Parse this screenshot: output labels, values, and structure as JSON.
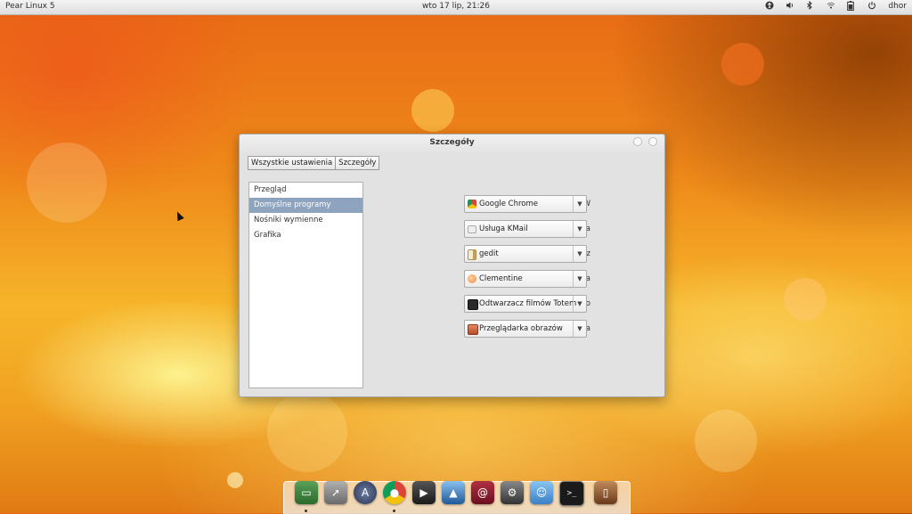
{
  "topbar": {
    "distro": "Pear Linux 5",
    "clock": "wto 17 lip, 21:26",
    "user": "dhor",
    "indicators": [
      "accessibility-icon",
      "volume-icon",
      "bluetooth-icon",
      "wifi-icon",
      "battery-icon",
      "power-icon"
    ]
  },
  "window": {
    "title": "Szczegóły",
    "breadcrumbs": [
      "Wszystkie ustawienia",
      "Szczegóły"
    ],
    "sidebar": {
      "items": [
        "Przegląd",
        "Domyślne programy",
        "Nośniki wymienne",
        "Grafika"
      ],
      "selected_index": 1
    },
    "defaults": [
      {
        "label": "WWW",
        "value": "Google Chrome",
        "icon": "chrome-icon",
        "icon_color": "#d6432f"
      },
      {
        "label": "Poczta",
        "value": "Usługa KMail",
        "icon": "mail-icon",
        "icon_color": "#c9c9c9"
      },
      {
        "label": "Kalendarz",
        "value": "gedit",
        "icon": "text-editor-icon",
        "icon_color": "#e8d8a0"
      },
      {
        "label": "Muzyka",
        "value": "Clementine",
        "icon": "clementine-icon",
        "icon_color": "#f39a5a"
      },
      {
        "label": "Wideo",
        "value": "Odtwarzacz filmów Totem",
        "icon": "video-icon",
        "icon_color": "#333333"
      },
      {
        "label": "Zdjęcia",
        "value": "Przeglądarka obrazów",
        "icon": "image-viewer-icon",
        "icon_color": "#c8603a"
      }
    ]
  },
  "dock": {
    "items": [
      {
        "name": "dock-system-monitor",
        "icon": "monitor-icon",
        "color": "#3a7a3a"
      },
      {
        "name": "dock-launcher",
        "icon": "rocket-icon",
        "color": "#8a8a8a"
      },
      {
        "name": "dock-app-store",
        "icon": "app-store-icon",
        "color": "#3a4a6a"
      },
      {
        "name": "dock-chrome",
        "icon": "chrome-icon",
        "color": "#d6432f"
      },
      {
        "name": "dock-media-player",
        "icon": "play-icon",
        "color": "#333333"
      },
      {
        "name": "dock-photos",
        "icon": "photos-icon",
        "color": "#2f6aa8"
      },
      {
        "name": "dock-mail",
        "icon": "mail-icon",
        "color": "#8a1a2a"
      },
      {
        "name": "dock-settings",
        "icon": "gear-icon",
        "color": "#555555"
      },
      {
        "name": "dock-messenger",
        "icon": "chat-icon",
        "color": "#4a90d0"
      },
      {
        "name": "dock-terminal",
        "icon": "terminal-icon",
        "color": "#1a1a1a"
      },
      {
        "name": "dock-trash",
        "icon": "trash-icon",
        "color": "#7a4a2a"
      }
    ]
  }
}
